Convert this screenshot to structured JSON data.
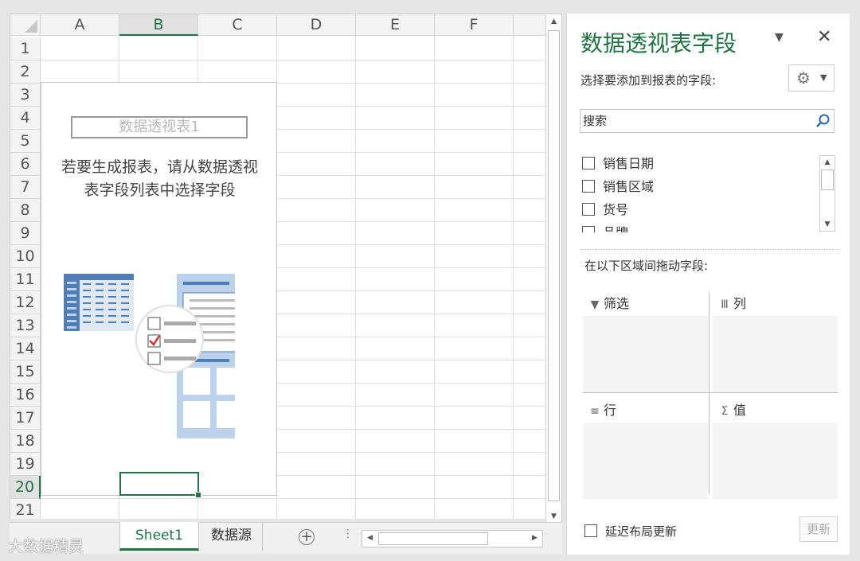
{
  "spreadsheet": {
    "columns": [
      "A",
      "B",
      "C",
      "D",
      "E",
      "F"
    ],
    "selected_column": "B",
    "rows": [
      "1",
      "2",
      "3",
      "4",
      "5",
      "6",
      "7",
      "8",
      "9",
      "10",
      "11",
      "12",
      "13",
      "14",
      "15",
      "16",
      "17",
      "18",
      "19",
      "20",
      "21"
    ],
    "selected_row": "20",
    "pivot_placeholder": {
      "title": "数据透视表1",
      "instruction_line1": "若要生成报表，请从数据透视",
      "instruction_line2": "表字段列表中选择字段"
    }
  },
  "sheet_tabs": {
    "tabs": [
      {
        "label": "Sheet1",
        "active": true
      },
      {
        "label": "数据源",
        "active": false
      }
    ],
    "add_label": "+"
  },
  "watermark": "大数据精灵",
  "field_pane": {
    "title": "数据透视表字段",
    "subtitle": "选择要添加到报表的字段:",
    "search_placeholder": "搜索",
    "fields": [
      {
        "label": "销售日期",
        "checked": false
      },
      {
        "label": "销售区域",
        "checked": false
      },
      {
        "label": "货号",
        "checked": false
      },
      {
        "label": "品牌",
        "checked": false
      }
    ],
    "drag_label": "在以下区域间拖动字段:",
    "areas": {
      "filter": "筛选",
      "columns": "列",
      "rows": "行",
      "values": "值"
    },
    "defer_label": "延迟布局更新",
    "update_label": "更新"
  },
  "colors": {
    "accent": "#217346",
    "pivot_blue": "#4f7db5",
    "pivot_light": "#bcd2ea",
    "check_red": "#c0392b"
  }
}
